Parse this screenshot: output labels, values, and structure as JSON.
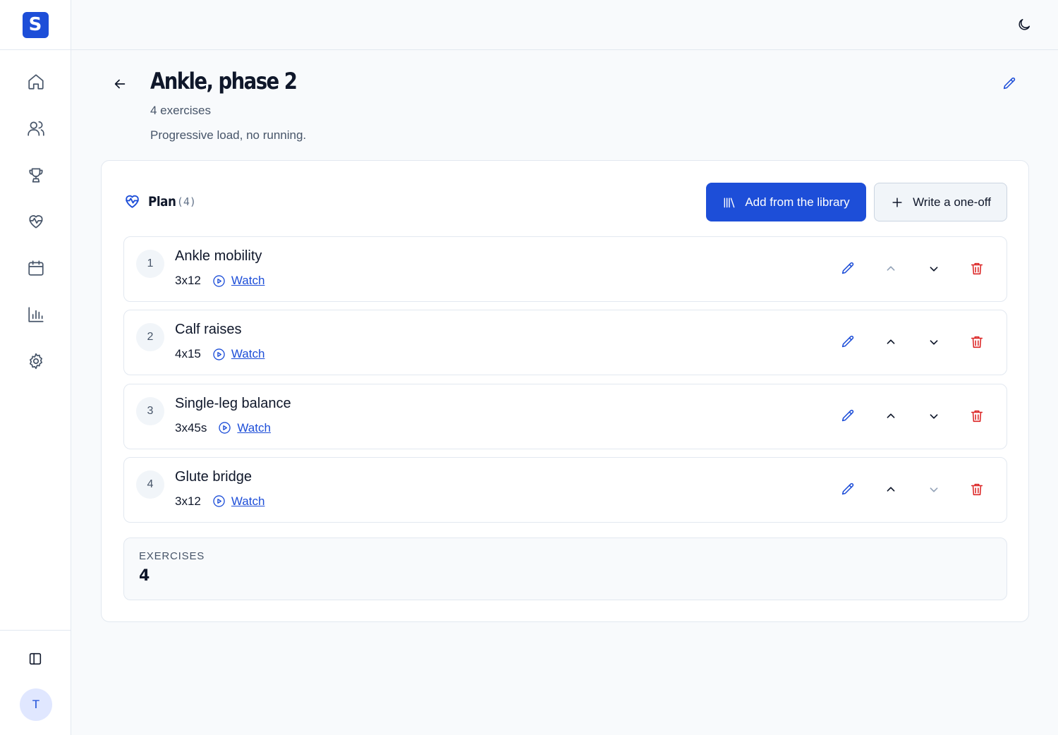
{
  "app": {
    "logo_letter": "S",
    "accent": "#1d4ed8",
    "danger": "#dc2626"
  },
  "sidebar": {
    "items": [
      {
        "icon": "home-icon"
      },
      {
        "icon": "users-icon"
      },
      {
        "icon": "trophy-icon"
      },
      {
        "icon": "heart-pulse-icon"
      },
      {
        "icon": "calendar-icon"
      },
      {
        "icon": "bar-chart-icon"
      },
      {
        "icon": "gear-icon"
      }
    ],
    "collapse_icon": "panel-left-icon",
    "avatar_initial": "T"
  },
  "topbar": {
    "theme_icon": "moon-icon"
  },
  "header": {
    "title": "Ankle, phase 2",
    "subtitle": "4 exercises",
    "description": "Progressive load, no running."
  },
  "plan": {
    "title": "Plan",
    "count": "(4)",
    "add_library_label": "Add from the library",
    "write_oneoff_label": "Write a one-off",
    "watch_label": "Watch",
    "exercises": [
      {
        "number": "1",
        "name": "Ankle mobility",
        "sets": "3x12",
        "can_move_up": false,
        "can_move_down": true
      },
      {
        "number": "2",
        "name": "Calf raises",
        "sets": "4x15",
        "can_move_up": true,
        "can_move_down": true
      },
      {
        "number": "3",
        "name": "Single-leg balance",
        "sets": "3x45s",
        "can_move_up": true,
        "can_move_down": true
      },
      {
        "number": "4",
        "name": "Glute bridge",
        "sets": "3x12",
        "can_move_up": true,
        "can_move_down": false
      }
    ],
    "stats": {
      "label": "EXERCISES",
      "value": "4"
    }
  }
}
